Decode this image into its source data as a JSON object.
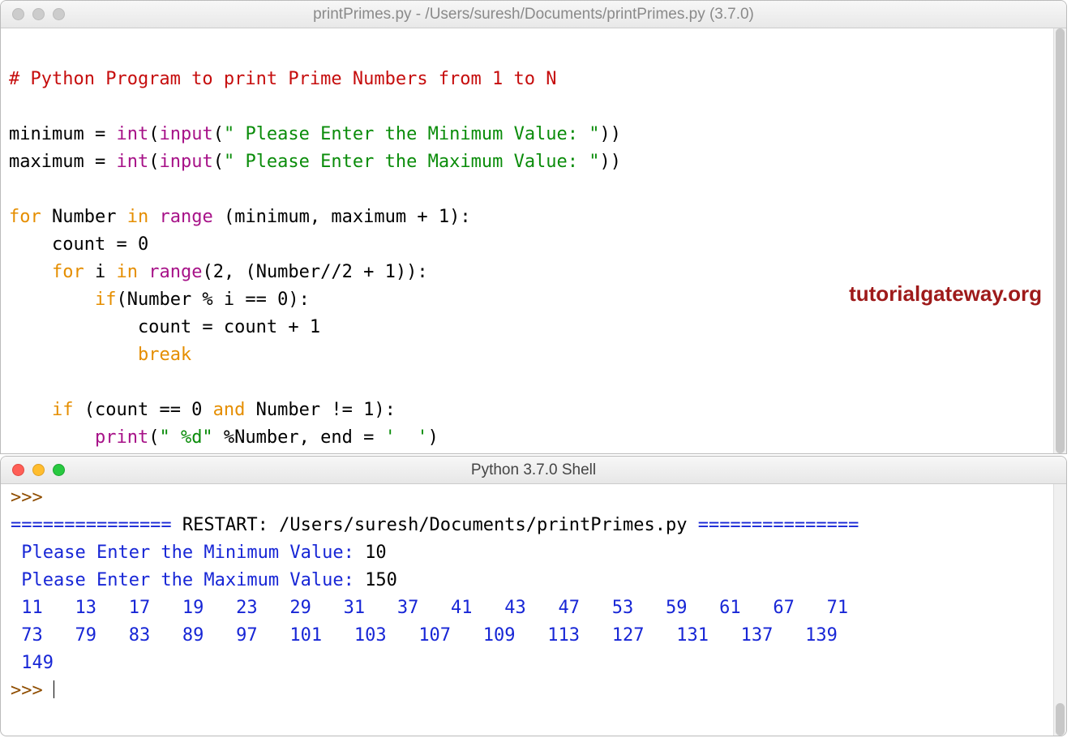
{
  "editor": {
    "title": "printPrimes.py - /Users/suresh/Documents/printPrimes.py (3.7.0)",
    "code": {
      "comment": "# Python Program to print Prime Numbers from 1 to N",
      "l2_minimum": "minimum ",
      "l2_eq": "= ",
      "l2_int": "int",
      "l2_paren1": "(",
      "l2_input": "input",
      "l2_paren2": "(",
      "l2_str": "\" Please Enter the Minimum Value: \"",
      "l2_close": "))",
      "l3_maximum": "maximum ",
      "l3_eq": "= ",
      "l3_int": "int",
      "l3_paren1": "(",
      "l3_input": "input",
      "l3_paren2": "(",
      "l3_str": "\" Please Enter the Maximum Value: \"",
      "l3_close": "))",
      "l5_for": "for",
      "l5_number": " Number ",
      "l5_in": "in",
      "l5_sp": " ",
      "l5_range": "range",
      "l5_rest": " (minimum, maximum + 1):",
      "l6": "    count = 0",
      "l7_indent": "    ",
      "l7_for": "for",
      "l7_i": " i ",
      "l7_in": "in",
      "l7_sp": " ",
      "l7_range": "range",
      "l7_rest": "(2, (Number//2 + 1)):",
      "l8_indent": "        ",
      "l8_if": "if",
      "l8_rest": "(Number % i == 0):",
      "l9": "            count = count + 1",
      "l10_indent": "            ",
      "l10_break": "break",
      "l12_indent": "    ",
      "l12_if": "if",
      "l12_mid": " (count == 0 ",
      "l12_and": "and",
      "l12_rest": " Number != 1):",
      "l13_indent": "        ",
      "l13_print": "print",
      "l13_p1": "(",
      "l13_s1": "\" %d\"",
      "l13_mid": " %Number, end = ",
      "l13_s2": "'  '",
      "l13_close": ")"
    },
    "watermark": "tutorialgateway.org"
  },
  "shell": {
    "title": "Python 3.7.0 Shell",
    "prompt1": ">>>",
    "restart_eq1": "=============== ",
    "restart_label": "RESTART: /Users/suresh/Documents/printPrimes.py",
    "restart_eq2": " ===============",
    "min_prompt": " Please Enter the Minimum Value: ",
    "min_val": "10",
    "max_prompt": " Please Enter the Maximum Value: ",
    "max_val": "150",
    "primes_row1": " 11   13   17   19   23   29   31   37   41   43   47   53   59   61   67   71  ",
    "primes_row2": " 73   79   83   89   97   101   103   107   109   113   127   131   137   139  ",
    "primes_row3": " 149  ",
    "prompt2": ">>> "
  }
}
